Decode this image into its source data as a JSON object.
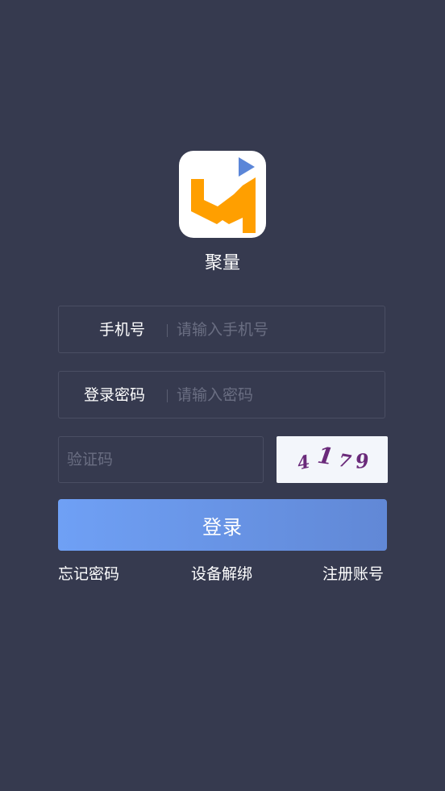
{
  "app": {
    "name": "聚量",
    "logo_icon": "app-logo-icon",
    "logo_colors": {
      "mark": "#ff9f00",
      "play": "#5b86d8"
    }
  },
  "form": {
    "phone": {
      "label": "手机号",
      "placeholder": "请输入手机号"
    },
    "password": {
      "label": "登录密码",
      "placeholder": "请输入密码"
    },
    "captcha": {
      "placeholder": "验证码",
      "image_text": [
        "4",
        "1",
        "7",
        "9"
      ]
    }
  },
  "actions": {
    "login_label": "登录",
    "forgot_password": "忘记密码",
    "unbind_device": "设备解绑",
    "register": "注册账号"
  },
  "colors": {
    "background": "#363a4f",
    "button_gradient_start": "#6fa0f5",
    "button_gradient_end": "#6188d6",
    "captcha_text": "#6a2a7a"
  }
}
